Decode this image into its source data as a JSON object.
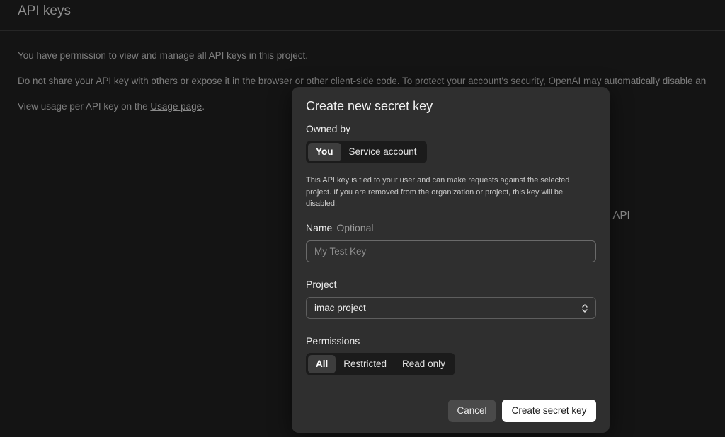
{
  "page": {
    "title": "API keys",
    "intro": "You have permission to view and manage all API keys in this project.",
    "warning": "Do not share your API key with others or expose it in the browser or other client-side code. To protect your account's security, OpenAI may automatically disable an",
    "usage_prefix": "View usage per API key on the ",
    "usage_link": "Usage page",
    "usage_suffix": ".",
    "background_fragment": "I API"
  },
  "modal": {
    "title": "Create new secret key",
    "owned_by": {
      "label": "Owned by",
      "options": [
        "You",
        "Service account"
      ],
      "selected": "You"
    },
    "help_text": "This API key is tied to your user and can make requests against the selected project. If you are removed from the organization or project, this key will be disabled.",
    "name": {
      "label": "Name",
      "optional_label": "Optional",
      "placeholder": "My Test Key",
      "value": ""
    },
    "project": {
      "label": "Project",
      "selected": "imac project",
      "icon": "chevron-up-down-icon"
    },
    "permissions": {
      "label": "Permissions",
      "options": [
        "All",
        "Restricted",
        "Read only"
      ],
      "selected": "All"
    },
    "buttons": {
      "cancel": "Cancel",
      "create": "Create secret key"
    }
  },
  "colors": {
    "page_background": "#141414",
    "modal_background": "#2f2f2f",
    "segment_background": "#1b1b1b",
    "segment_active": "#3d3d3d",
    "primary_button": "#ffffff",
    "secondary_button": "#4a4a4a"
  }
}
